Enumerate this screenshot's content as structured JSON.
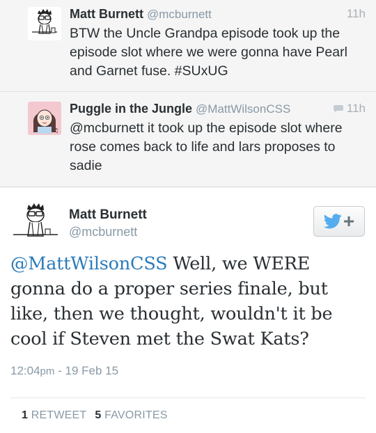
{
  "thread": [
    {
      "name": "Matt Burnett",
      "handle": "@mcburnett",
      "time": "11h",
      "text": "BTW the Uncle Grandpa episode took up the episode slot where we were gonna have Pearl and Garnet fuse. #SUxUG",
      "avatar_icon": "cartoon-glasses-man-avatar"
    },
    {
      "name": "Puggle in the Jungle",
      "handle": "@MattWilsonCSS",
      "time": "11h",
      "text": "@mcburnett it took up the episode slot where rose comes back to life and lars proposes to sadie",
      "avatar_icon": "cartoon-girl-avatar",
      "reply_icon": "speech-bubble-icon"
    }
  ],
  "detail": {
    "name": "Matt Burnett",
    "handle": "@mcburnett",
    "mention": "@MattWilsonCSS",
    "text": " Well, we WERE gonna do a proper series finale, but like, then we thought, wouldn't it be cool if Steven met the Swat Kats?",
    "time": "12:04",
    "ampm": "pm",
    "date": " - 19 Feb 15",
    "follow_icon": "twitter-bird-icon",
    "follow_plus": "+",
    "retweets_count": "1",
    "retweets_label": "RETWEET",
    "favorites_count": "5",
    "favorites_label": "FAVORITES"
  },
  "colors": {
    "link": "#2b7bb9",
    "twitter_blue": "#55acee",
    "muted": "#8899a6"
  }
}
